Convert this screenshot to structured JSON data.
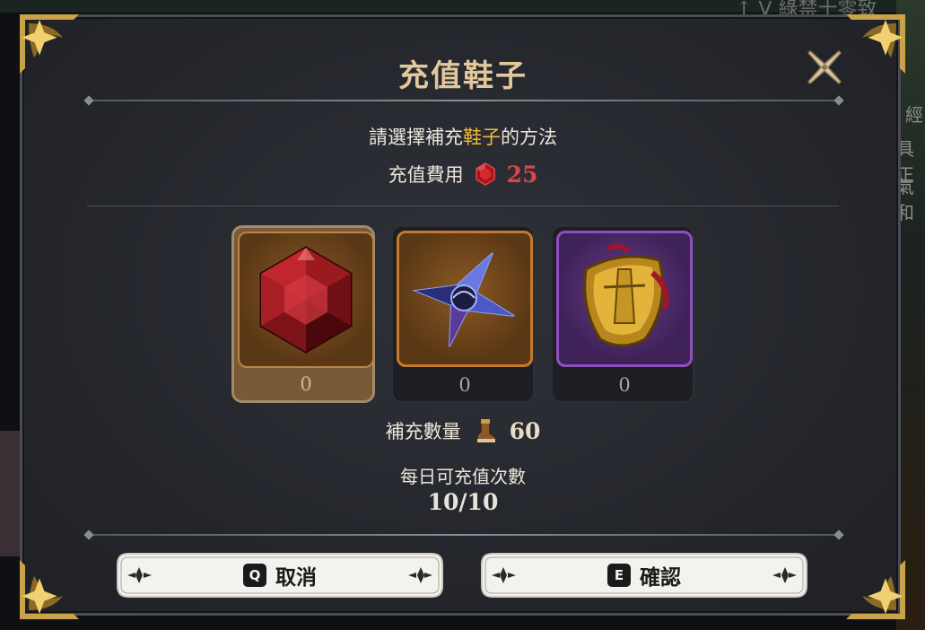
{
  "dialog": {
    "title": "充值鞋子",
    "prompt_prefix": "請選擇補充",
    "prompt_highlight": "鞋子",
    "prompt_suffix": "的方法",
    "cost_label": "充值費用",
    "cost_value": "25",
    "cost_icon": "red-gem-icon"
  },
  "options": [
    {
      "name": "red-gem-option",
      "icon": "red-gem-icon",
      "count": "0",
      "selected": true,
      "rarity_color": "#b8844a"
    },
    {
      "name": "star-shard-option",
      "icon": "blue-star-shard-icon",
      "count": "0",
      "selected": false,
      "rarity_color": "#c57a2b"
    },
    {
      "name": "golden-shield-option",
      "icon": "golden-shield-icon",
      "count": "0",
      "selected": false,
      "rarity_color": "#8e4fc0"
    }
  ],
  "refill": {
    "label": "補充數量",
    "icon": "boot-icon",
    "value": "60"
  },
  "daily": {
    "label": "每日可充值次數",
    "value": "10/10"
  },
  "buttons": {
    "cancel_key": "Q",
    "cancel_label": "取消",
    "confirm_key": "E",
    "confirm_label": "確認"
  },
  "background": {
    "top_text": "↑ 𝖵 綠禁十零致",
    "side_texts": [
      "經",
      "具正",
      "氣和"
    ]
  },
  "colors": {
    "title_gold": "#e2c89a",
    "highlight": "#f0b93b",
    "cost_red": "#d9474a",
    "panel_bg": "#26282e"
  }
}
